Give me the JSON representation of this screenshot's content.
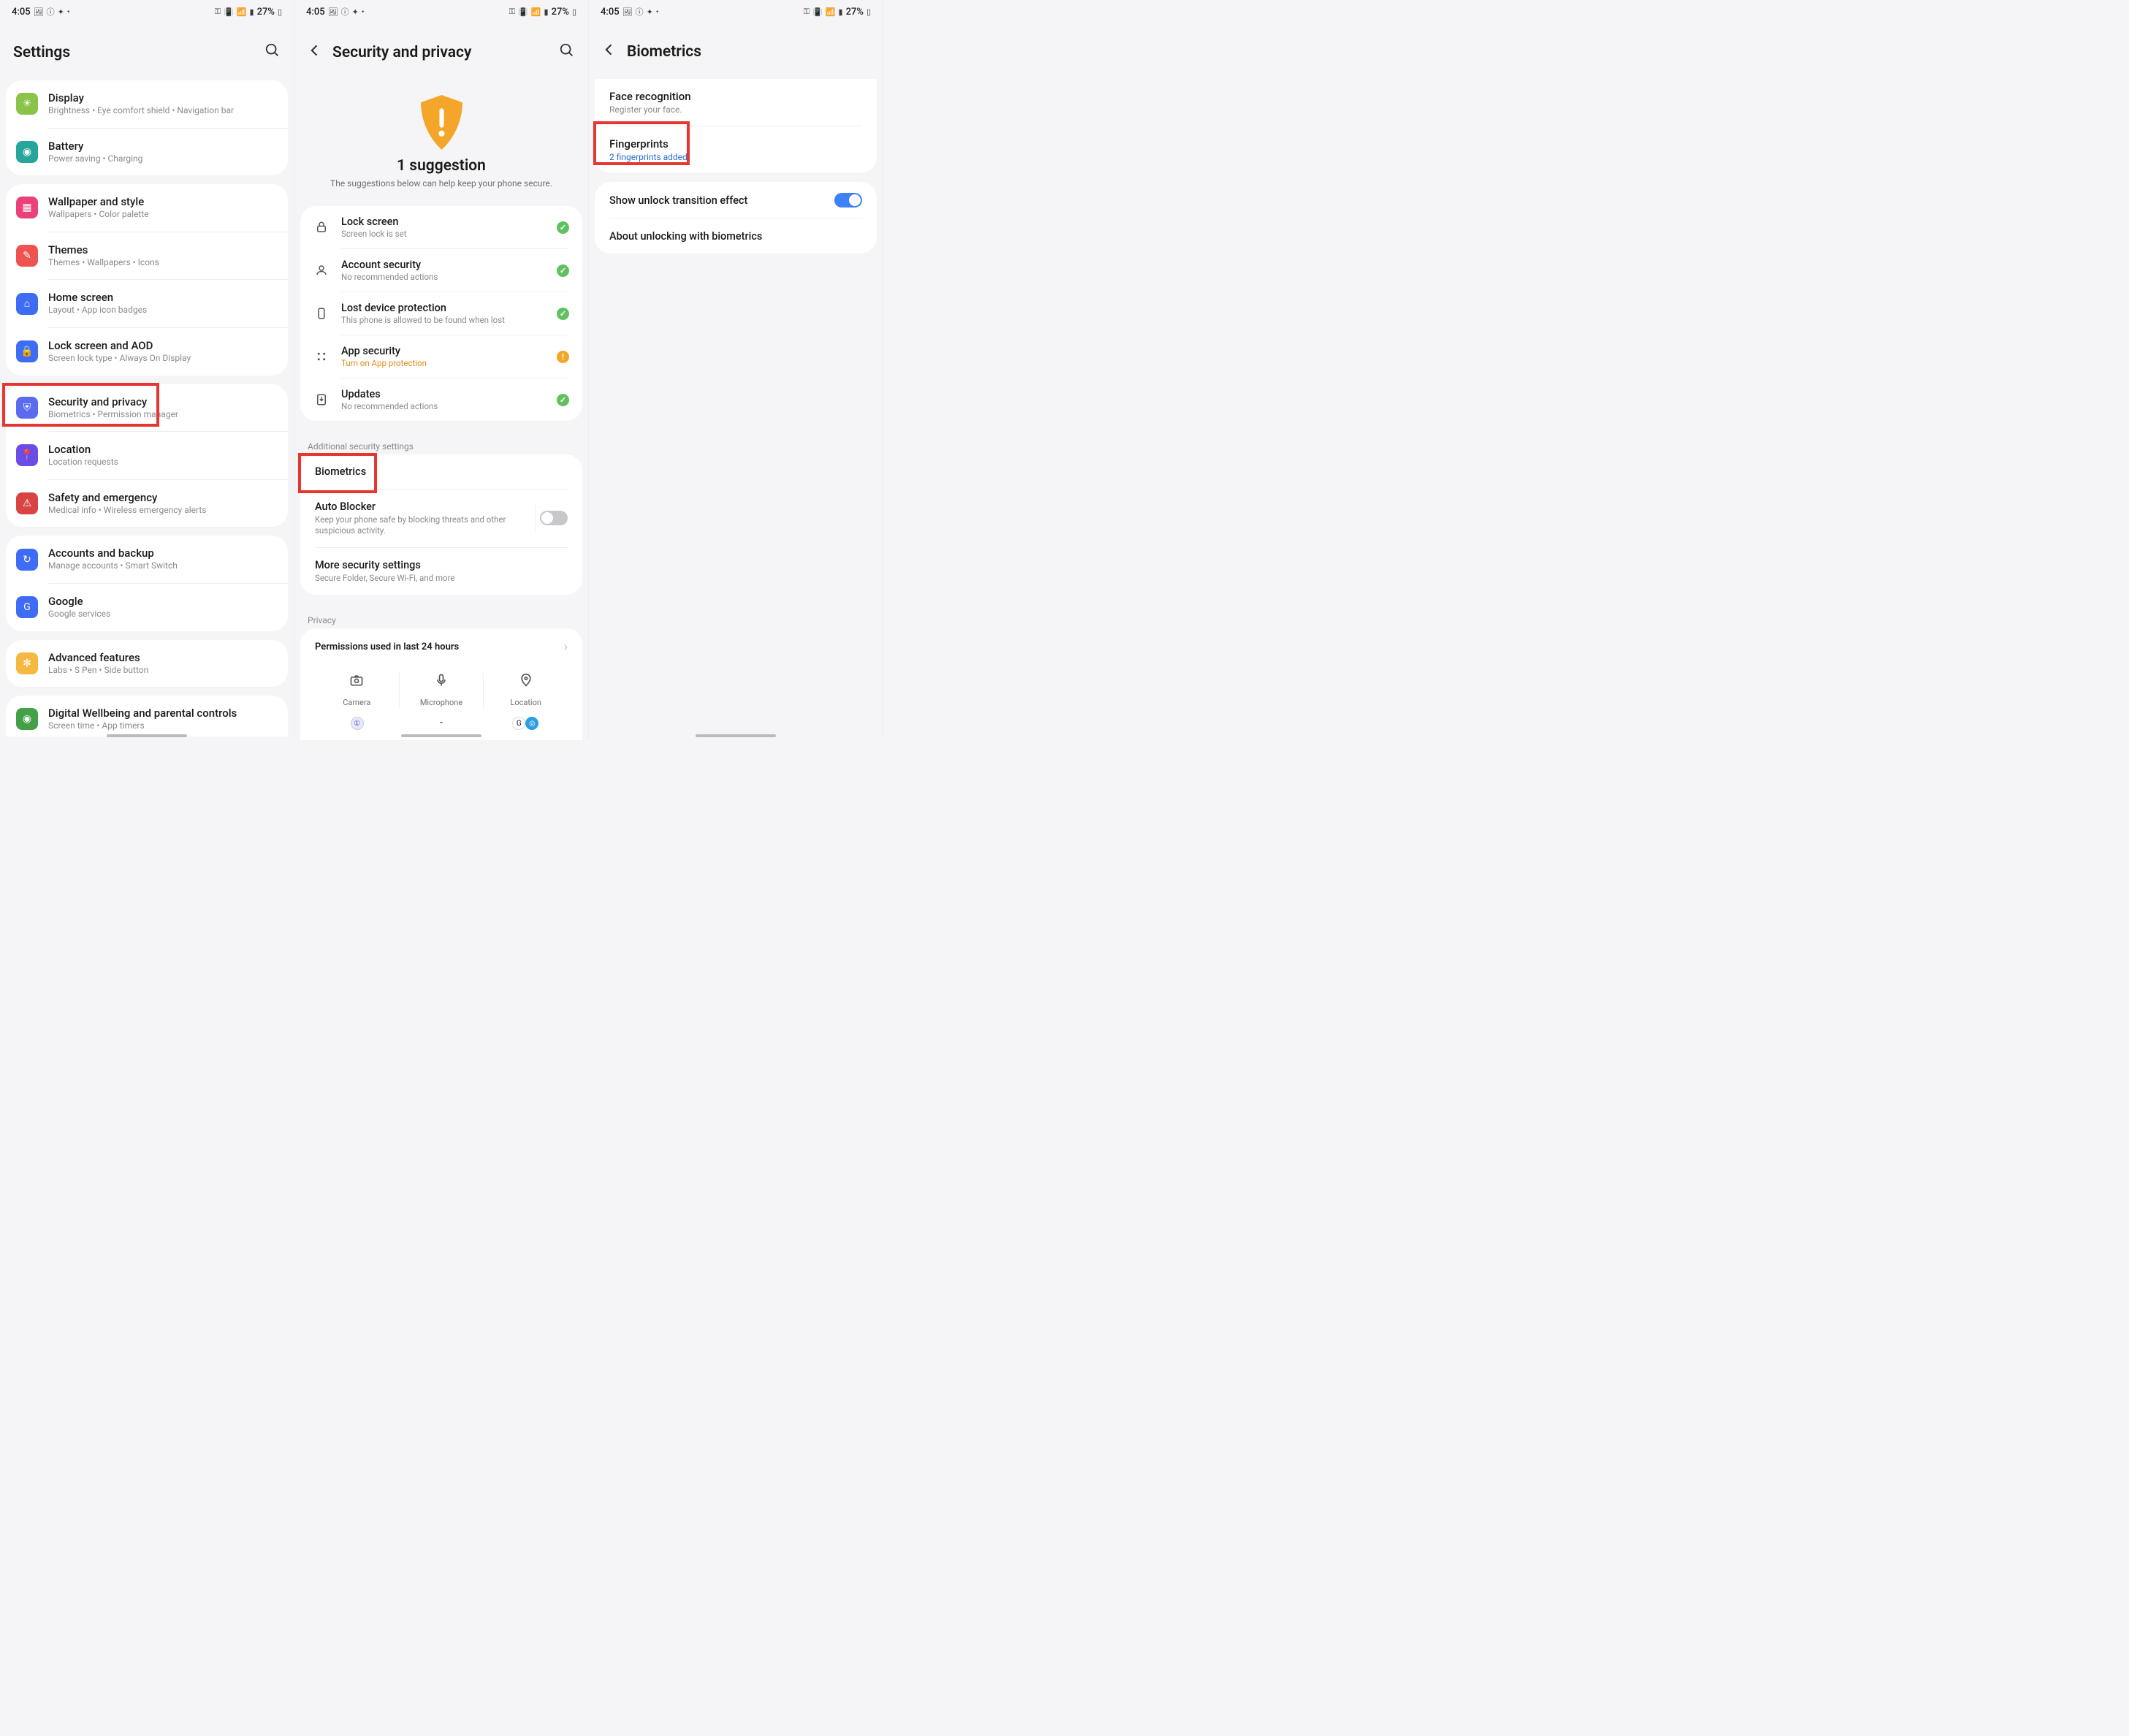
{
  "status": {
    "time": "4:05",
    "battery": "27%"
  },
  "screen1": {
    "title": "Settings",
    "items": [
      {
        "title": "Display",
        "sub": "Brightness  •  Eye comfort shield  •  Navigation bar",
        "color": "#8bc34a"
      },
      {
        "title": "Battery",
        "sub": "Power saving  •  Charging",
        "color": "#26a69a"
      },
      {
        "title": "Wallpaper and style",
        "sub": "Wallpapers  •  Color palette",
        "color": "#ec407a"
      },
      {
        "title": "Themes",
        "sub": "Themes  •  Wallpapers  •  Icons",
        "color": "#ef5350"
      },
      {
        "title": "Home screen",
        "sub": "Layout  •  App icon badges",
        "color": "#3f6cf5"
      },
      {
        "title": "Lock screen and AOD",
        "sub": "Screen lock type  •  Always On Display",
        "color": "#3f6cf5"
      },
      {
        "title": "Security and privacy",
        "sub": "Biometrics  •  Permission manager",
        "color": "#5b6bf0"
      },
      {
        "title": "Location",
        "sub": "Location requests",
        "color": "#6b4de6"
      },
      {
        "title": "Safety and emergency",
        "sub": "Medical info  •  Wireless emergency alerts",
        "color": "#d84343"
      },
      {
        "title": "Accounts and backup",
        "sub": "Manage accounts  •  Smart Switch",
        "color": "#3f6cf5"
      },
      {
        "title": "Google",
        "sub": "Google services",
        "color": "#3f6cf5"
      },
      {
        "title": "Advanced features",
        "sub": "Labs  •  S Pen  •  Side button",
        "color": "#f5b942"
      },
      {
        "title": "Digital Wellbeing and parental controls",
        "sub": "Screen time  •  App timers",
        "color": "#43a047"
      }
    ]
  },
  "screen2": {
    "title": "Security and privacy",
    "suggestion_title": "1 suggestion",
    "suggestion_sub": "The suggestions below can help keep your phone secure.",
    "sec_items": [
      {
        "title": "Lock screen",
        "sub": "Screen lock is set",
        "badge": "green"
      },
      {
        "title": "Account security",
        "sub": "No recommended actions",
        "badge": "green"
      },
      {
        "title": "Lost device protection",
        "sub": "This phone is allowed to be found when lost",
        "badge": "green"
      },
      {
        "title": "App security",
        "sub": "Turn on App protection",
        "badge": "orange"
      },
      {
        "title": "Updates",
        "sub": "No recommended actions",
        "badge": "green"
      }
    ],
    "additional_label": "Additional security settings",
    "biometrics": "Biometrics",
    "auto_blocker": {
      "title": "Auto Blocker",
      "sub": "Keep your phone safe by blocking threats and other suspicious activity."
    },
    "more": {
      "title": "More security settings",
      "sub": "Secure Folder, Secure Wi-Fi, and more"
    },
    "privacy_label": "Privacy",
    "permissions_title": "Permissions used in last 24 hours",
    "perm_cols": [
      "Camera",
      "Microphone",
      "Location"
    ],
    "perm_apps_mid": "-"
  },
  "screen3": {
    "title": "Biometrics",
    "face": {
      "title": "Face recognition",
      "sub": "Register your face."
    },
    "finger": {
      "title": "Fingerprints",
      "sub": "2 fingerprints added"
    },
    "transition": "Show unlock transition effect",
    "about": "About unlocking with biometrics"
  }
}
